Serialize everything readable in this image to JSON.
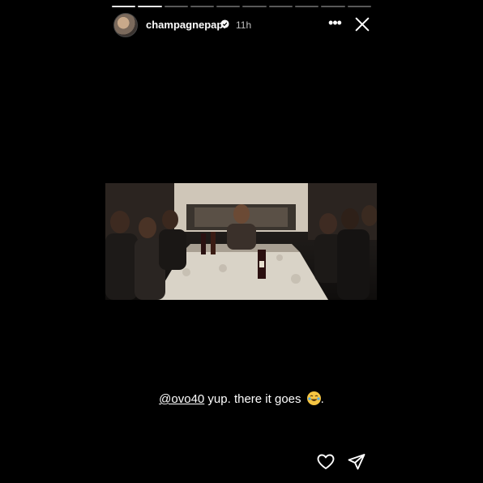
{
  "story": {
    "progress": {
      "total_segments": 10,
      "completed_segments": 2
    },
    "header": {
      "username": "champagnepapi",
      "timestamp": "11h",
      "verified": true,
      "more_icon": "more-horizontal-icon",
      "close_icon": "close-icon"
    },
    "media": {
      "type": "video-still",
      "scene": "dinner-table"
    },
    "caption": {
      "mention": "@ovo40",
      "text": " yup. there it goes ",
      "emoji": "face-with-tears-of-joy",
      "trailing": "."
    },
    "actions": {
      "like_icon": "heart-icon",
      "share_icon": "send-icon"
    },
    "colors": {
      "background": "#000000",
      "text": "#ffffff"
    }
  }
}
